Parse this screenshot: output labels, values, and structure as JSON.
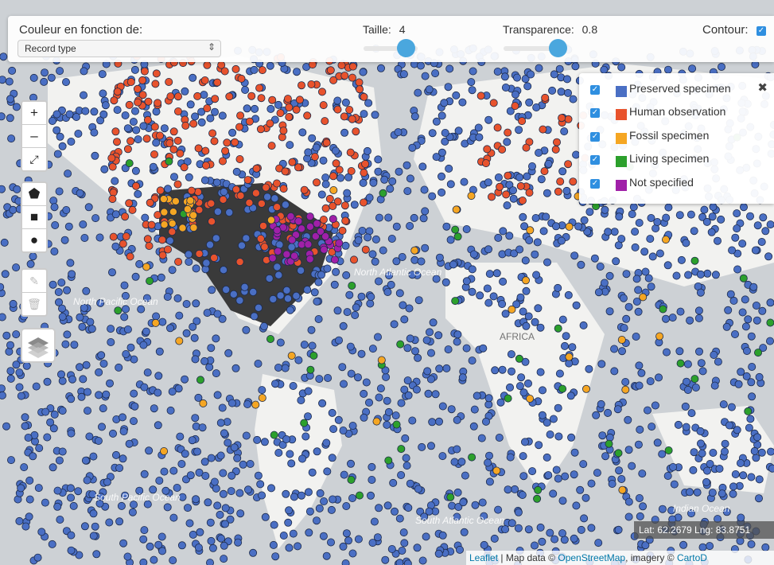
{
  "toolbar": {
    "color_label": "Couleur en fonction de:",
    "color_select": "Record type",
    "size_label": "Taille:",
    "size_value": "4",
    "opacity_label": "Transparence:",
    "opacity_value": "0.8",
    "contour_label": "Contour:"
  },
  "legend": {
    "items": [
      {
        "label": "Preserved specimen",
        "color": "#4a6fc4"
      },
      {
        "label": "Human observation",
        "color": "#e8532d"
      },
      {
        "label": "Fossil specimen",
        "color": "#f5a623"
      },
      {
        "label": "Living specimen",
        "color": "#2ca02c"
      },
      {
        "label": "Not specified",
        "color": "#a020a8"
      }
    ]
  },
  "map_labels": {
    "north_pacific": "North Pacific Ocean",
    "south_pacific": "South Pacific Ocean",
    "south_atlantic": "South Atlantic Ocean",
    "indian": "Indian Ocean",
    "north_atlantic": "North Atlantic Ocean",
    "africa": "AFRICA"
  },
  "coords": "Lat: 62.2679 Lng: 83.8751",
  "attribution": {
    "leaflet": "Leaflet",
    "text1": " | Map data © ",
    "osm": "OpenStreetMap",
    "text2": ", imagery © ",
    "carto": "CartoD"
  }
}
